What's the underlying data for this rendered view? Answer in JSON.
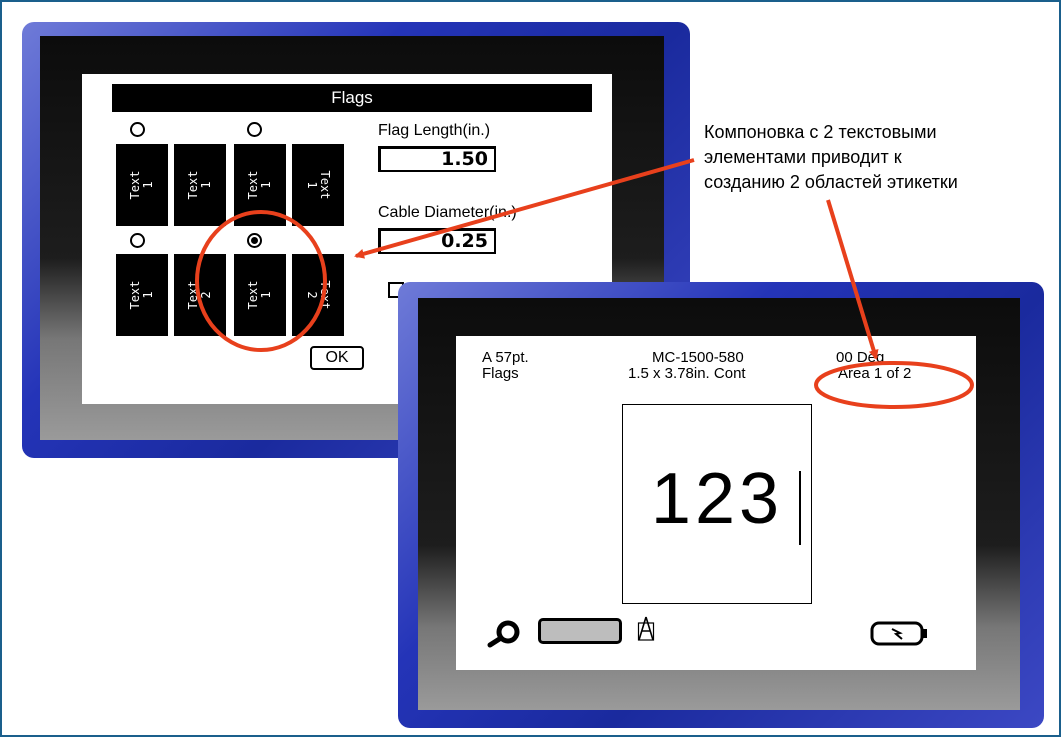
{
  "annotation": {
    "lines": [
      "Компоновка с 2 текстовыми",
      "элементами приводит к",
      "созданию 2 областей этикетки"
    ]
  },
  "flags_dialog": {
    "title": "Flags",
    "layouts": [
      {
        "flags": [
          "Text\n1",
          "Text\n1"
        ],
        "selected": false
      },
      {
        "flags": [
          "Text\n1",
          "Text\n1"
        ],
        "selected": false
      },
      {
        "flags": [
          "Text\n1",
          "Text\n2"
        ],
        "selected": false
      },
      {
        "flags": [
          "Text\n1",
          "Text\n2"
        ],
        "selected": true
      }
    ],
    "flag_length_label": "Flag Length(in.)",
    "flag_length_value": "1.50",
    "cable_diameter_label": "Cable Diameter(in.)",
    "cable_diameter_value": "0.25",
    "ok_label": "OK"
  },
  "editor": {
    "font_info": "A 57pt.",
    "mode": "Flags",
    "part_number": "MC-1500-580",
    "size_info": "1.5 x 3.78in.  Cont",
    "rotation": "00 Deg",
    "area_info": "Area  1 of 2",
    "label_text": "123",
    "icons": [
      "ribbon-icon",
      "cartridge-gauge",
      "font-icon",
      "battery-icon"
    ]
  },
  "colors": {
    "bezel_blue": "#2434b8",
    "highlight_red": "#e8401c",
    "frame_border": "#1a5f8c"
  }
}
